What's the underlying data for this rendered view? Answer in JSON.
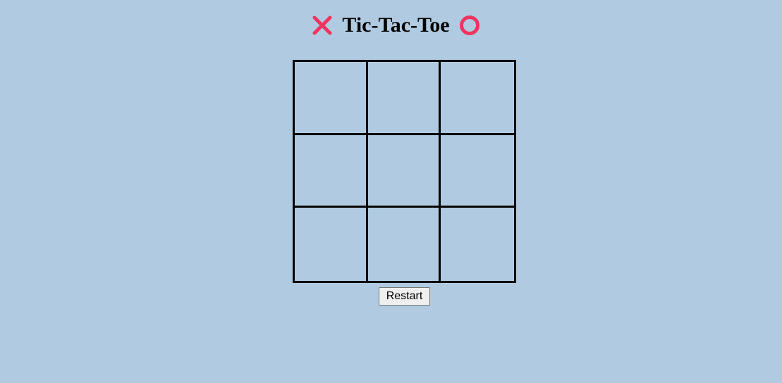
{
  "header": {
    "title": "Tic-Tac-Toe",
    "left_icon": "x-mark-icon",
    "right_icon": "o-ring-icon",
    "accent_color": "#f0335f"
  },
  "board": {
    "cells": [
      "",
      "",
      "",
      "",
      "",
      "",
      "",
      "",
      ""
    ]
  },
  "controls": {
    "restart_label": "Restart"
  },
  "colors": {
    "background": "#b0cbe1",
    "grid": "#000000"
  }
}
